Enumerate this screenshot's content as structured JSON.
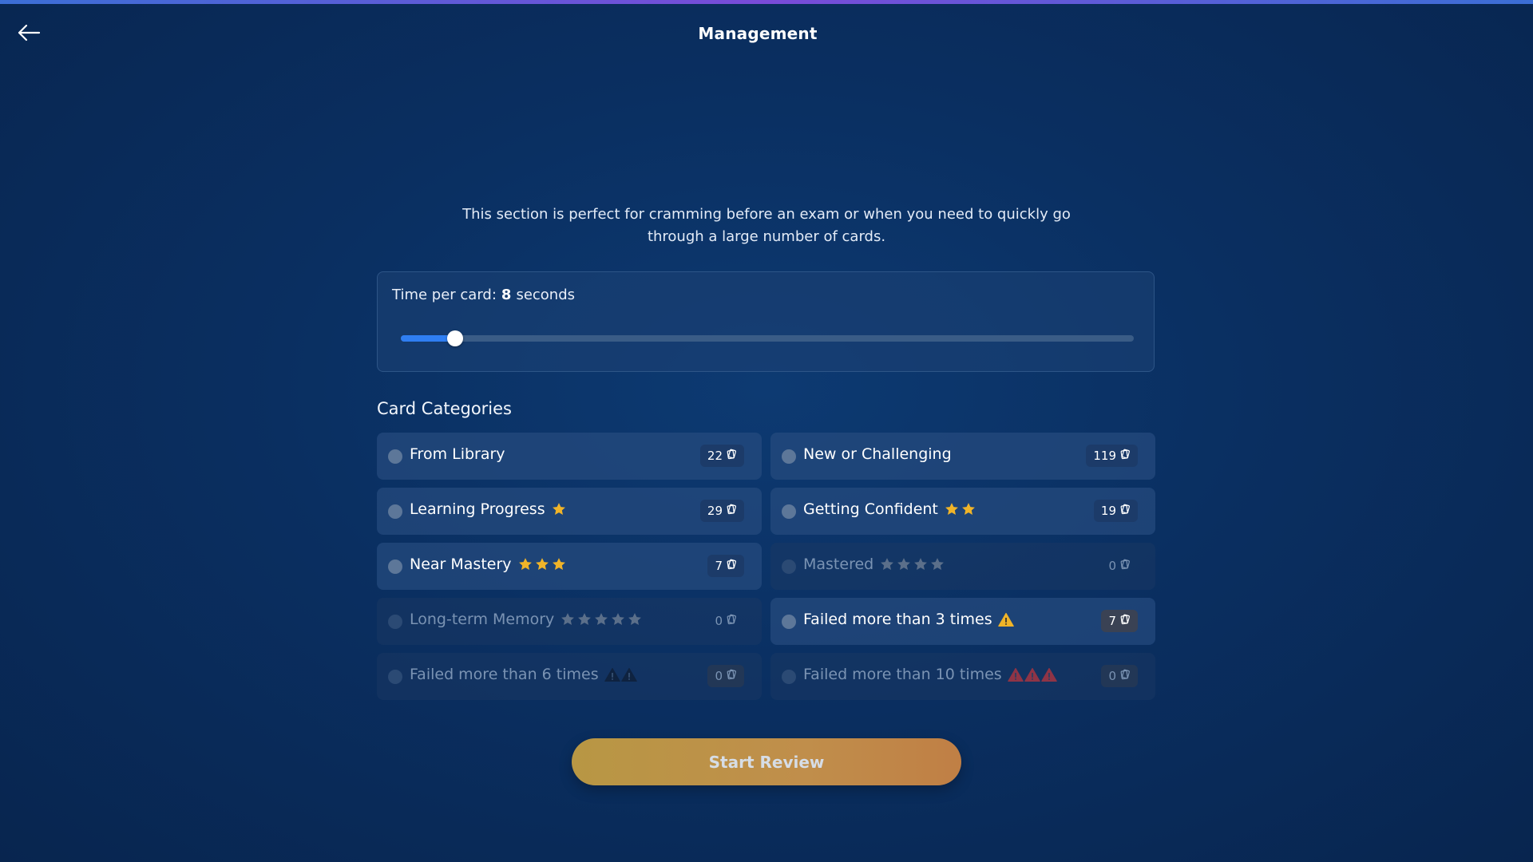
{
  "header": {
    "title": "Management",
    "back_icon": "arrow-left-icon"
  },
  "intro": {
    "text": "This section is perfect for cramming before an exam or when you need to quickly go through a large number of cards."
  },
  "time_per_card": {
    "label": "Time per card:",
    "value": "8",
    "unit": "seconds",
    "slider_fraction": 0.063
  },
  "categories": {
    "heading": "Card Categories",
    "items": [
      {
        "label": "From Library",
        "count": "22",
        "icon": "none",
        "enabled": true
      },
      {
        "label": "New or Challenging",
        "count": "119",
        "icon": "none",
        "enabled": true
      },
      {
        "label": "Learning Progress",
        "count": "29",
        "icon": "star-icon",
        "icon_count": 1,
        "enabled": true
      },
      {
        "label": "Getting Confident",
        "count": "19",
        "icon": "star-icon",
        "icon_count": 2,
        "enabled": true
      },
      {
        "label": "Near Mastery",
        "count": "7",
        "icon": "star-icon",
        "icon_count": 3,
        "enabled": true
      },
      {
        "label": "Mastered",
        "count": "0",
        "icon": "star-icon",
        "icon_count": 4,
        "enabled": false
      },
      {
        "label": "Long-term Memory",
        "count": "0",
        "icon": "star-icon",
        "icon_count": 5,
        "enabled": false
      },
      {
        "label": "Failed more than 3 times",
        "count": "7",
        "icon": "warning-icon",
        "icon_count": 1,
        "enabled": true
      },
      {
        "label": "Failed more than 6 times",
        "count": "0",
        "icon": "warning-icon",
        "icon_count": 2,
        "enabled": false
      },
      {
        "label": "Failed more than 10 times",
        "count": "0",
        "icon": "warning-icon",
        "icon_count": 3,
        "enabled": false
      }
    ]
  },
  "actions": {
    "start_label": "Start Review"
  },
  "colors": {
    "accent": "#2f7ef2",
    "star": "#f0b429",
    "warning": "#f0b429",
    "danger": "#d64545",
    "start_button": "#c08e4b"
  }
}
